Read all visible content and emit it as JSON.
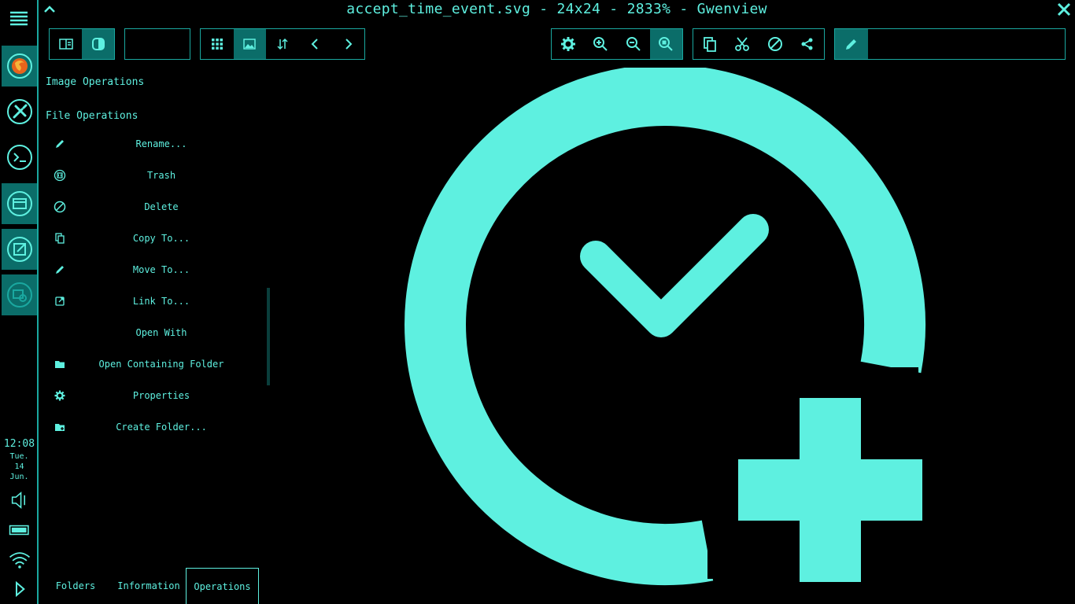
{
  "window": {
    "title": "accept_time_event.svg - 24x24 - 2833% - Gwenview"
  },
  "dock": {
    "apps": [
      {
        "name": "firefox-icon"
      },
      {
        "name": "settings-tools-icon"
      },
      {
        "name": "terminal-icon"
      },
      {
        "name": "archive-icon"
      },
      {
        "name": "notes-icon"
      },
      {
        "name": "image-viewer-icon"
      }
    ],
    "clock": {
      "time": "12:08",
      "day": "Tue.",
      "date": "14",
      "month": "Jun."
    },
    "tray": [
      "volume-icon",
      "battery-icon",
      "wifi-icon",
      "expand-icon"
    ]
  },
  "panel": {
    "sections": {
      "image_ops": "Image Operations",
      "file_ops": "File Operations"
    },
    "operations": [
      {
        "label": "Rename...",
        "icon": "pencil-icon"
      },
      {
        "label": "Trash",
        "icon": "trash-icon"
      },
      {
        "label": "Delete",
        "icon": "delete-icon"
      },
      {
        "label": "Copy To...",
        "icon": "copy-icon"
      },
      {
        "label": "Move To...",
        "icon": "pencil-icon"
      },
      {
        "label": "Link To...",
        "icon": "link-icon"
      },
      {
        "label": "Open With",
        "icon": ""
      },
      {
        "label": "Open Containing Folder",
        "icon": "folder-icon"
      },
      {
        "label": "Properties",
        "icon": "gear-icon"
      },
      {
        "label": "Create Folder...",
        "icon": "folder-new-icon"
      }
    ],
    "tabs": [
      {
        "label": "Folders",
        "selected": false
      },
      {
        "label": "Information",
        "selected": false
      },
      {
        "label": "Operations",
        "selected": true
      }
    ]
  },
  "colors": {
    "accent": "#5ef0e0",
    "active_bg": "#0b6d69",
    "border": "#1aa8a0",
    "background": "#000000"
  }
}
